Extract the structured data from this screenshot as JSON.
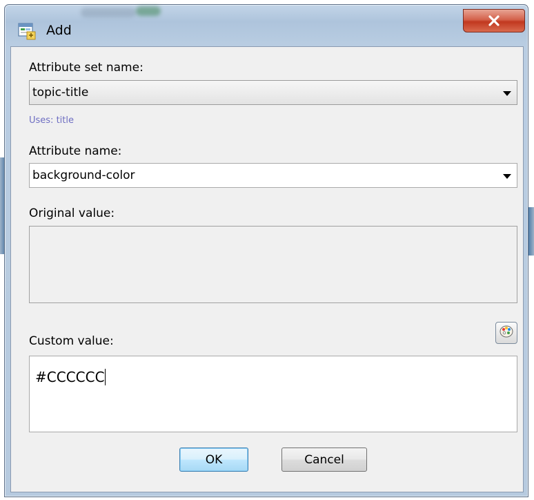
{
  "window": {
    "title": "Add"
  },
  "form": {
    "attribute_set_label": "Attribute set name:",
    "attribute_set_value": "topic-title",
    "uses_text": "Uses: title",
    "attribute_name_label": "Attribute name:",
    "attribute_name_value": "background-color",
    "original_value_label": "Original value:",
    "original_value": "",
    "custom_value_label": "Custom value:",
    "custom_value": "#CCCCCC"
  },
  "buttons": {
    "ok": "OK",
    "cancel": "Cancel"
  },
  "icons": {
    "app": "dialog-app-icon",
    "close": "close-icon",
    "palette": "color-palette-icon",
    "dropdown": "chevron-down-icon"
  },
  "colors": {
    "close_button": "#c1381f",
    "default_button": "#bee6fd",
    "hint_text": "#6e6ec2",
    "dialog_background": "#f0f0f0"
  }
}
